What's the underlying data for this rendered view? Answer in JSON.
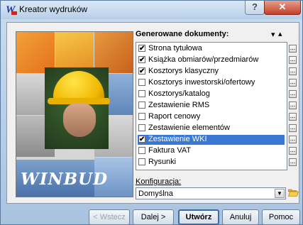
{
  "window": {
    "title": "Kreator wydruków",
    "help_label": "?",
    "close_label": "✕"
  },
  "image_panel": {
    "logo_text": "WINBUD"
  },
  "documents": {
    "heading": "Generowane dokumenty:",
    "sort_down": "▾",
    "sort_up": "▴",
    "more_label": "...",
    "items": [
      {
        "label": "Strona tytułowa",
        "checked": true,
        "mark": "✔"
      },
      {
        "label": "Książka obmiarów/przedmiarów",
        "checked": true,
        "mark": "✔"
      },
      {
        "label": "Kosztorys klasyczny",
        "checked": true,
        "mark": "✔"
      },
      {
        "label": "Kosztorys inwestorski/ofertowy",
        "checked": false,
        "mark": ""
      },
      {
        "label": "Kosztorys/katalog",
        "checked": false,
        "mark": ""
      },
      {
        "label": "Zestawienie RMS",
        "checked": false,
        "mark": ""
      },
      {
        "label": "Raport cenowy",
        "checked": false,
        "mark": ""
      },
      {
        "label": "Zestawienie elementów",
        "checked": false,
        "mark": ""
      },
      {
        "label": "Zestawienie WKI",
        "checked": true,
        "mark": "✔",
        "selected": true
      },
      {
        "label": "Faktura VAT",
        "checked": false,
        "mark": ""
      },
      {
        "label": "Rysunki",
        "checked": false,
        "mark": ""
      }
    ]
  },
  "config": {
    "label": "Konfiguracja:",
    "value": "Domyślna",
    "arrow": "▼"
  },
  "footer": {
    "back": "< Wstecz",
    "next": "Dalej >",
    "create": "Utwórz",
    "cancel": "Anuluj",
    "help": "Pomoc"
  },
  "colors": {
    "selection": "#3a78d4",
    "close_button": "#c2402a"
  }
}
